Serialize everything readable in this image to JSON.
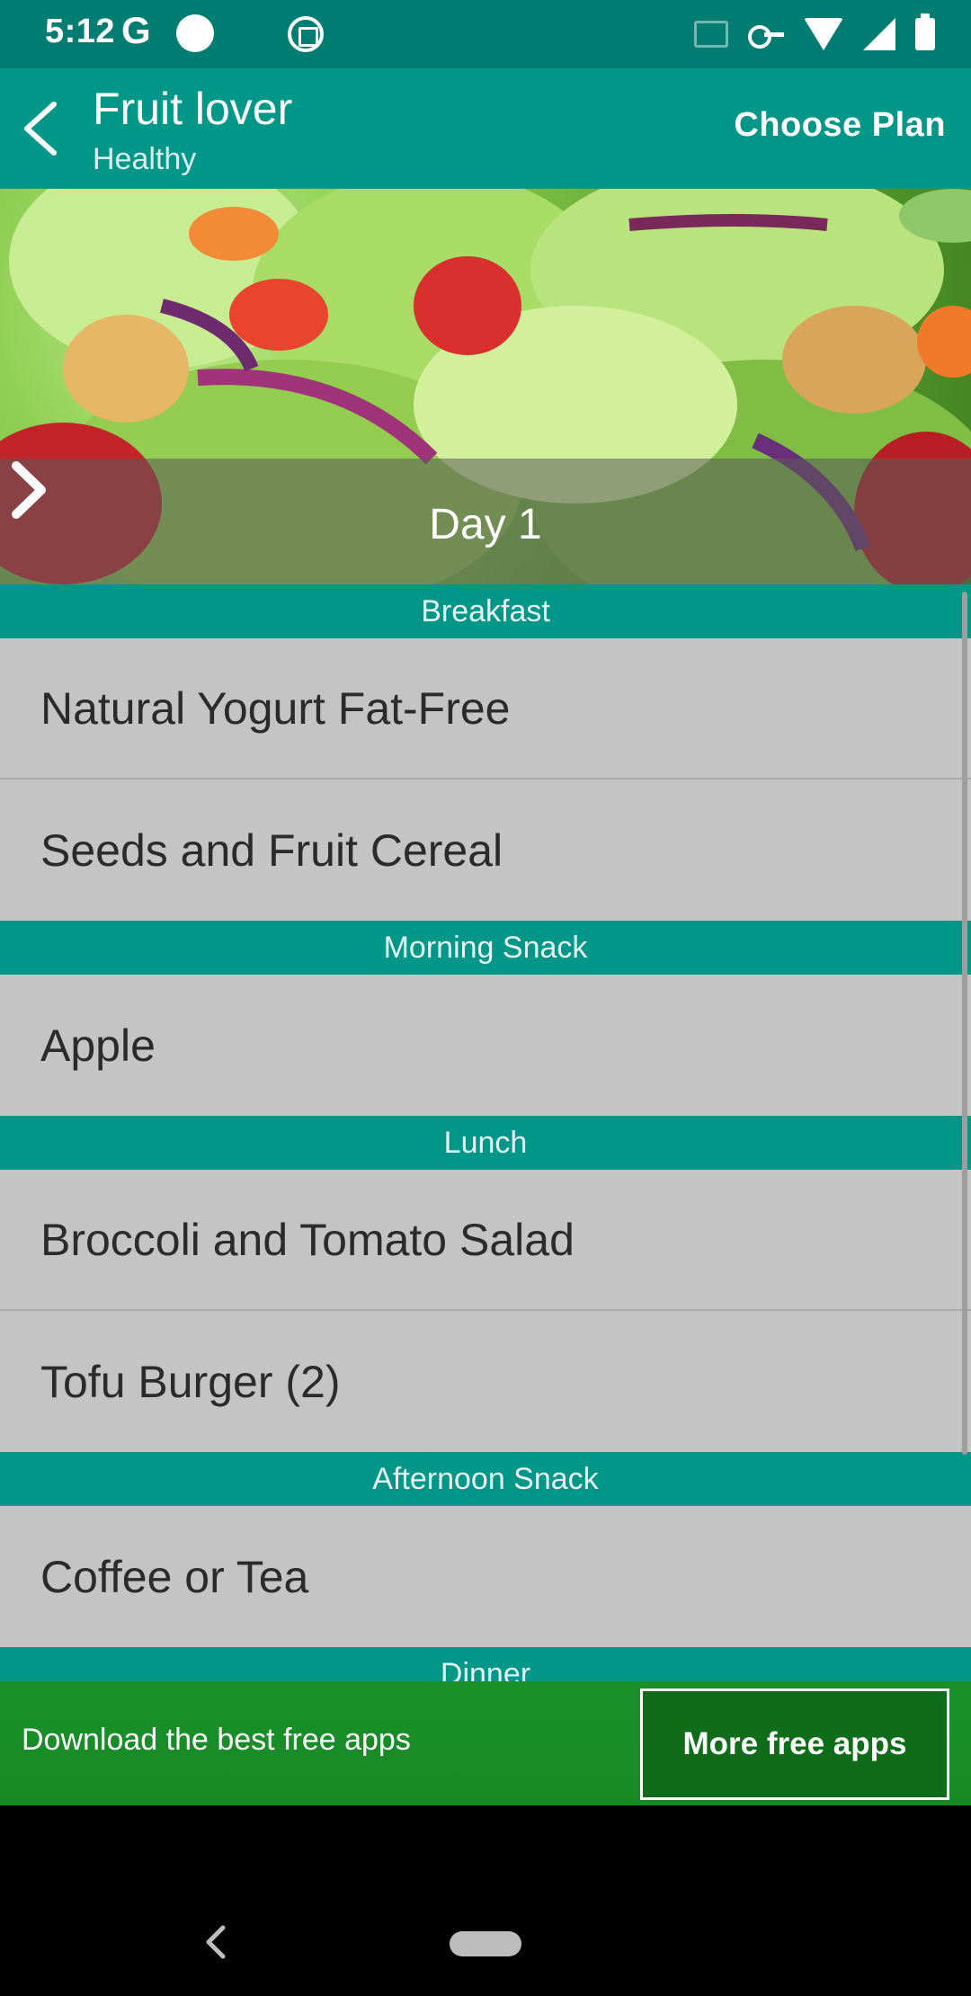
{
  "status_bar": {
    "time": "5:12",
    "g_label": "G",
    "icons": [
      "google-icon",
      "circle-notification-icon",
      "app-notification-icon",
      "cast-icon",
      "vpn-key-icon",
      "wifi-icon",
      "cell-signal-icon",
      "battery-charging-icon"
    ]
  },
  "app_bar": {
    "title": "Fruit lover",
    "subtitle": "Healthy",
    "action_label": "Choose Plan",
    "background": "#009688"
  },
  "hero": {
    "day_label": "Day 1"
  },
  "sections": [
    {
      "header": "Breakfast",
      "items": [
        "Natural Yogurt Fat-Free",
        "Seeds and Fruit Cereal"
      ]
    },
    {
      "header": "Morning Snack",
      "items": [
        "Apple"
      ]
    },
    {
      "header": "Lunch",
      "items": [
        "Broccoli and Tomato Salad",
        "Tofu Burger (2)"
      ]
    },
    {
      "header": "Afternoon Snack",
      "items": [
        "Coffee or Tea"
      ]
    },
    {
      "header": "Dinner",
      "items": []
    }
  ],
  "ad_banner": {
    "text": "Download the best free apps",
    "button_label": "More free apps"
  },
  "colors": {
    "accent": "#009688",
    "status_bar": "#007d73",
    "list_bg": "#c4c4c4",
    "ad_green": "#188a25"
  }
}
